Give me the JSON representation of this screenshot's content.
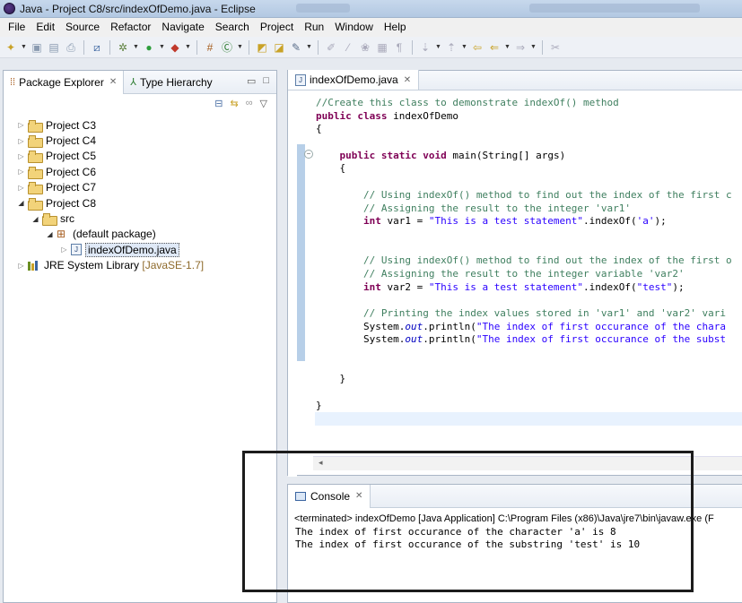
{
  "window": {
    "title": "Java - Project C8/src/indexOfDemo.java - Eclipse"
  },
  "menu": [
    "File",
    "Edit",
    "Source",
    "Refactor",
    "Navigate",
    "Search",
    "Project",
    "Run",
    "Window",
    "Help"
  ],
  "left_tabs": {
    "package_explorer": "Package Explorer",
    "type_hierarchy": "Type Hierarchy"
  },
  "tree": {
    "projects": [
      "Project C3",
      "Project C4",
      "Project C5",
      "Project C6",
      "Project C7",
      "Project C8"
    ],
    "src": "src",
    "default_package": "(default package)",
    "file": "indexOfDemo.java",
    "jre": "JRE System Library",
    "jre_version": "[JavaSE-1.7]"
  },
  "editor": {
    "tab": "indexOfDemo.java",
    "lines": [
      "//Create this class to demonstrate indexOf() method",
      "public class indexOfDemo",
      "{",
      "",
      "    public static void main(String[] args)",
      "    {",
      "",
      "        // Using indexOf() method to find out the index of the first c",
      "        // Assigning the result to the integer 'var1'",
      "        int var1 = \"This is a test statement\".indexOf('a');",
      "",
      "",
      "        // Using indexOf() method to find out the index of the first o",
      "        // Assigning the result to the integer variable 'var2'",
      "        int var2 = \"This is a test statement\".indexOf(\"test\");",
      "",
      "        // Printing the index values stored in 'var1' and 'var2' vari",
      "        System.out.println(\"The index of first occurance of the chara",
      "        System.out.println(\"The index of first occurance of the subst",
      "",
      "",
      "    }",
      "",
      "}"
    ]
  },
  "console": {
    "tab": "Console",
    "status": "<terminated> indexOfDemo [Java Application] C:\\Program Files (x86)\\Java\\jre7\\bin\\javaw.exe (F",
    "output": [
      "The index of first occurance of the character 'a' is 8",
      "The index of first occurance of the substring 'test' is 10"
    ]
  }
}
